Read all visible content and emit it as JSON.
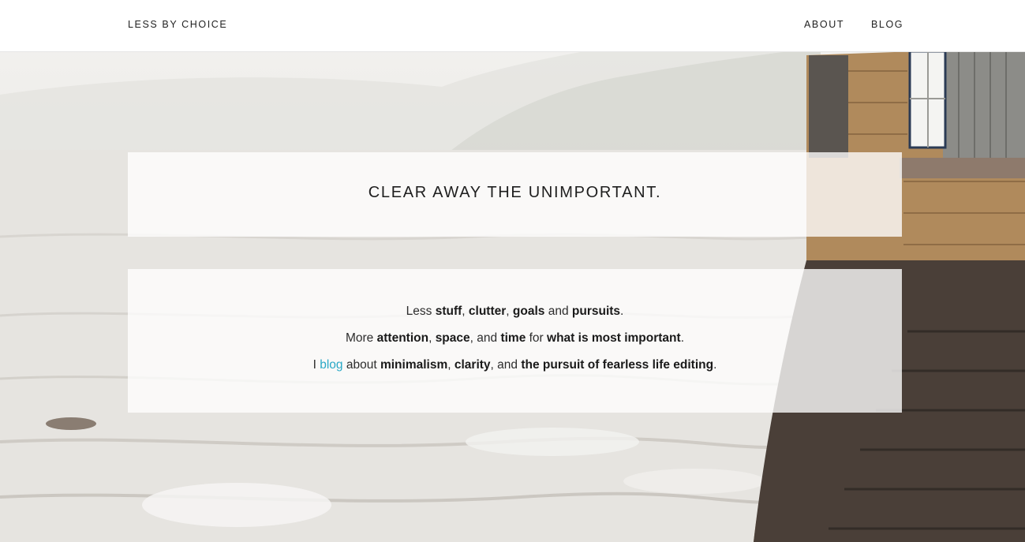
{
  "header": {
    "logo": "LESS BY CHOICE",
    "nav": [
      {
        "label": "ABOUT"
      },
      {
        "label": "BLOG"
      }
    ]
  },
  "hero": {
    "headline": "CLEAR AWAY THE UNIMPORTANT."
  },
  "intro": {
    "line1": {
      "w1": "Less",
      "b1": "stuff",
      "w2": ",",
      "b2": "clutter",
      "w3": ",",
      "b3": "goals",
      "w4": "and",
      "b4": "pursuits",
      "w5": "."
    },
    "line2": {
      "w1": "More",
      "b1": "attention",
      "w2": ",",
      "b2": "space",
      "w3": ", and",
      "b3": "time",
      "w4": "for",
      "b4": "what is most important",
      "w5": "."
    },
    "line3": {
      "w1": "I",
      "link": "blog",
      "w2": "about",
      "b1": "minimalism",
      "w3": ",",
      "b2": "clarity",
      "w4": ", and",
      "b3": "the pursuit of fearless life editing",
      "w5": "."
    }
  },
  "colors": {
    "link": "#29a8c6",
    "text": "#1e1e1e",
    "panel": "#ffffff"
  }
}
